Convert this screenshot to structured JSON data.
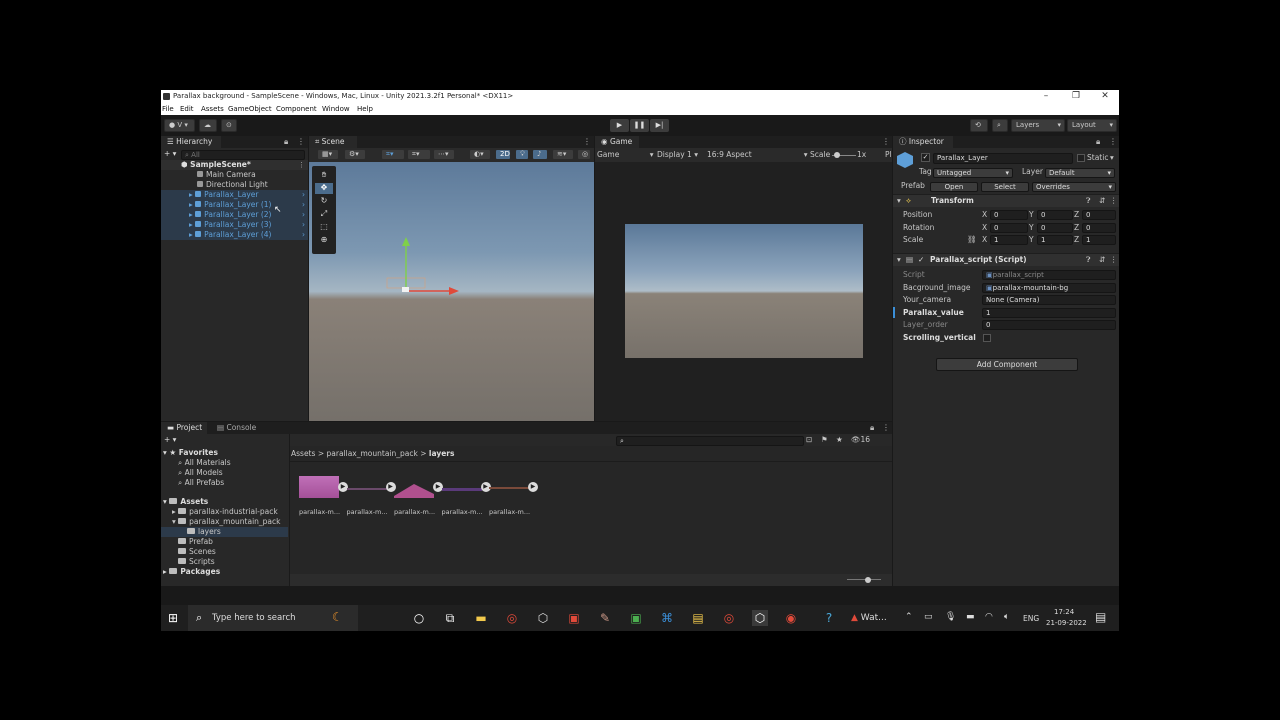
{
  "window": {
    "title": "Parallax background - SampleScene - Windows, Mac, Linux - Unity 2021.3.2f1 Personal* <DX11>",
    "menus": [
      "File",
      "Edit",
      "Assets",
      "GameObject",
      "Component",
      "Window",
      "Help"
    ]
  },
  "toolbar": {
    "account": "V",
    "layers_label": "Layers",
    "layout_label": "Layout",
    "play_icon": "play-icon",
    "pause_icon": "pause-icon",
    "step_icon": "step-icon"
  },
  "hierarchy": {
    "tab": "Hierarchy",
    "search_placeholder": "All",
    "scene_name": "SampleScene*",
    "items": [
      {
        "label": "Main Camera",
        "selected": false
      },
      {
        "label": "Directional Light",
        "selected": false
      },
      {
        "label": "Parallax_Layer",
        "selected": true
      },
      {
        "label": "Parallax_Layer (1)",
        "selected": true
      },
      {
        "label": "Parallax_Layer (2)",
        "selected": true
      },
      {
        "label": "Parallax_Layer (3)",
        "selected": true
      },
      {
        "label": "Parallax_Layer (4)",
        "selected": true
      }
    ]
  },
  "scene": {
    "tab": "Scene",
    "mode_2d": "2D"
  },
  "game": {
    "tab": "Game",
    "mode": "Game",
    "display": "Display 1",
    "aspect": "16:9 Aspect",
    "scale_label": "Scale",
    "scale_value": "1x",
    "extra": "Pl"
  },
  "inspector": {
    "tab": "Inspector",
    "object_name": "Parallax_Layer",
    "static_label": "Static",
    "tag_label": "Tag",
    "tag_value": "Untagged",
    "layer_label": "Layer",
    "layer_value": "Default",
    "prefab_label": "Prefab",
    "open_label": "Open",
    "select_label": "Select",
    "overrides_label": "Overrides",
    "transform": {
      "title": "Transform",
      "rows": [
        {
          "label": "Position",
          "x": "0",
          "y": "0",
          "z": "0"
        },
        {
          "label": "Rotation",
          "x": "0",
          "y": "0",
          "z": "0"
        },
        {
          "label": "Scale",
          "x": "1",
          "y": "1",
          "z": "1"
        }
      ]
    },
    "script": {
      "title": "Parallax_script (Script)",
      "fields": [
        {
          "label": "Script",
          "value": "parallax_script"
        },
        {
          "label": "Bacground_image",
          "value": "parallax-mountain-bg"
        },
        {
          "label": "Your_camera",
          "value": "None (Camera)"
        },
        {
          "label": "Parallax_value",
          "value": "1"
        },
        {
          "label": "Layer_order",
          "value": "0"
        },
        {
          "label": "Scrolling_vertical",
          "value": ""
        }
      ]
    },
    "add_component": "Add Component"
  },
  "project": {
    "tab_project": "Project",
    "tab_console": "Console",
    "hidden_count": "16",
    "favorites": {
      "label": "Favorites",
      "items": [
        "All Materials",
        "All Models",
        "All Prefabs"
      ]
    },
    "assets": {
      "label": "Assets",
      "items": [
        "parallax-industrial-pack",
        "parallax_mountain_pack",
        "layers",
        "Prefab",
        "Scenes",
        "Scripts"
      ]
    },
    "packages": "Packages",
    "breadcrumb": [
      "Assets",
      "parallax_mountain_pack",
      "layers"
    ],
    "breadcrumb_sep": ">",
    "files": [
      "parallax-m...",
      "parallax-m...",
      "parallax-m...",
      "parallax-m...",
      "parallax-m..."
    ]
  },
  "taskbar": {
    "search_placeholder": "Type here to search",
    "watch_label": "Wat...",
    "lang": "ENG",
    "time": "17:24",
    "date": "21-09-2022"
  }
}
